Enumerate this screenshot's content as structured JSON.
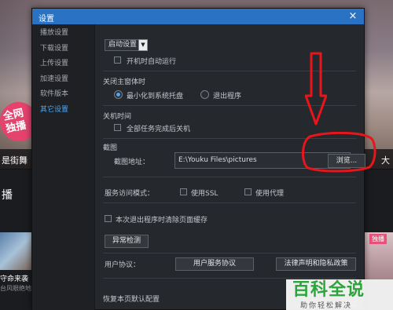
{
  "background": {
    "badge": "全网\n独播",
    "strip_left": "是街舞",
    "strip_right": "大",
    "section_title": "播",
    "thumb_title": "守命来袭",
    "thumb_sub": "台风眼绝地",
    "right_tag": "独播"
  },
  "dialog": {
    "title": "设置",
    "close_glyph": "×"
  },
  "sidebar": {
    "items": [
      {
        "label": "播放设置"
      },
      {
        "label": "下载设置"
      },
      {
        "label": "上传设置"
      },
      {
        "label": "加速设置"
      },
      {
        "label": "软件版本"
      },
      {
        "label": "其它设置"
      }
    ],
    "active_index": 5
  },
  "startup": {
    "select_value": "启动设置",
    "autorun_label": "开机时自动运行",
    "autorun_checked": false
  },
  "close_main": {
    "heading": "关闭主窗体时",
    "option_minimize": "最小化到系统托盘",
    "option_exit": "退出程序",
    "selected": "minimize"
  },
  "shutdown": {
    "heading": "关机时间",
    "label": "全部任务完成后关机",
    "checked": false
  },
  "screenshot": {
    "heading": "截图",
    "path_label": "截图地址：",
    "path_value": "E:\\Youku Files\\pictures",
    "browse_label": "浏览..."
  },
  "service": {
    "label": "服务访问模式：",
    "ssl_label": "使用SSL",
    "proxy_label": "使用代理",
    "ssl_checked": false,
    "proxy_checked": false
  },
  "cache": {
    "label": "本次退出程序时清除页面缓存",
    "checked": false,
    "detect_label": "异常检测"
  },
  "agreement": {
    "label": "用户协议：",
    "service_label": "用户服务协议",
    "privacy_label": "法律声明和隐私政策"
  },
  "footer": {
    "reset_label": "恢复本页默认配置"
  },
  "watermark": {
    "logo": "百科全说",
    "sub": "助你轻松解决"
  },
  "colors": {
    "accent": "#2a73c4",
    "active_item": "#4fa6f2",
    "annotation": "#e8151b",
    "watermark_green": "#2aa53a"
  }
}
